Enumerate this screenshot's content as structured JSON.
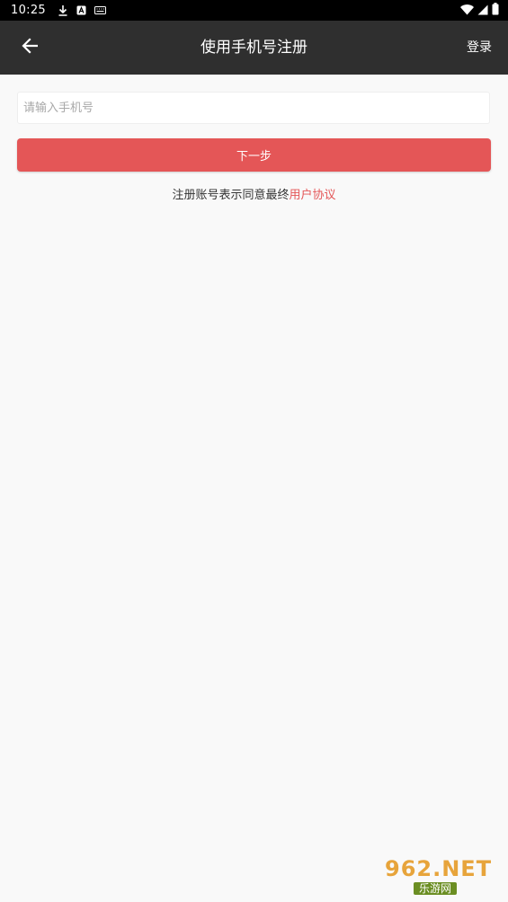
{
  "status_bar": {
    "time": "10:25",
    "icons": [
      "download-icon",
      "a-icon",
      "keyboard-icon",
      "wifi-icon",
      "signal-icon",
      "battery-icon"
    ]
  },
  "app_bar": {
    "back_icon": "arrow-left-icon",
    "title": "使用手机号注册",
    "login_label": "登录"
  },
  "form": {
    "phone_placeholder": "请输入手机号",
    "phone_value": "",
    "next_label": "下一步"
  },
  "agreement": {
    "prefix": "注册账号表示同意最终",
    "link_label": "用户协议"
  },
  "watermark": {
    "top": "962.NET",
    "bottom": "乐游网"
  },
  "colors": {
    "accent": "#e45657",
    "app_bar": "#2f2f2f",
    "background": "#f9f9f9"
  }
}
